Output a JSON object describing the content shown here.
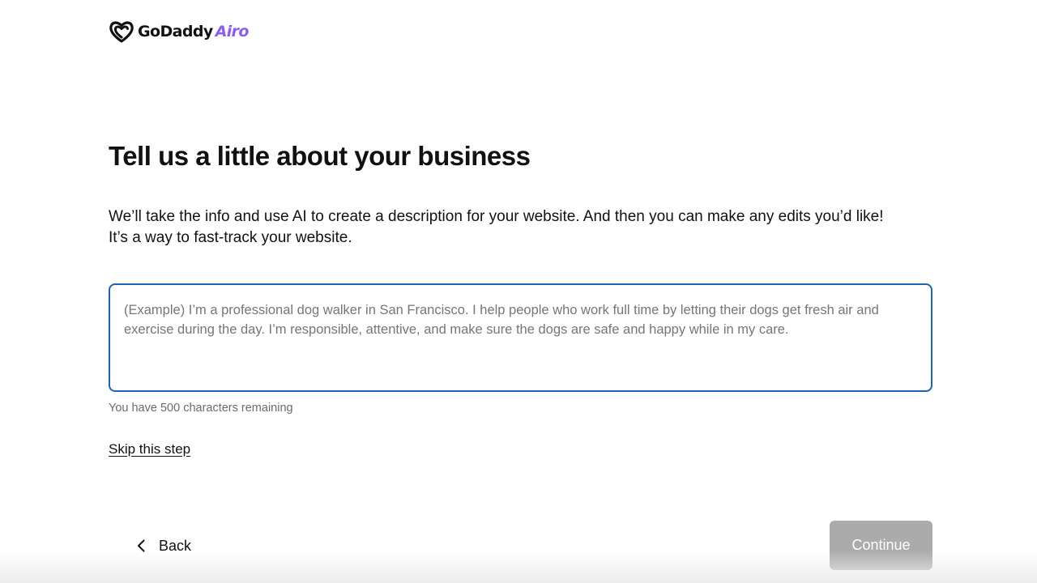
{
  "header": {
    "logo_text": "GoDaddy",
    "logo_suffix": "Airo",
    "logo_icon": "godaddy-heart-icon",
    "accent_color": "#8a5cf5"
  },
  "main": {
    "title": "Tell us a little about your business",
    "description_line1": "We’ll take the info and use AI to create a description for your website. And then you can make any edits you’d like!",
    "description_line2": "It’s a way to fast-track your website.",
    "business_input": {
      "value": "",
      "placeholder": "(Example) I’m a professional dog walker in San Francisco. I help people who work full time by letting their dogs get fresh air and exercise during the day. I’m responsible, attentive, and make sure the dogs are safe and happy while in my care.",
      "border_color": "#1e63b8"
    },
    "char_remaining_text": "You have 500 characters remaining",
    "skip_label": "Skip this step"
  },
  "footer": {
    "back_label": "Back",
    "back_icon": "chevron-left-icon",
    "continue_label": "Continue",
    "continue_disabled": true,
    "continue_color": "#ababab"
  }
}
